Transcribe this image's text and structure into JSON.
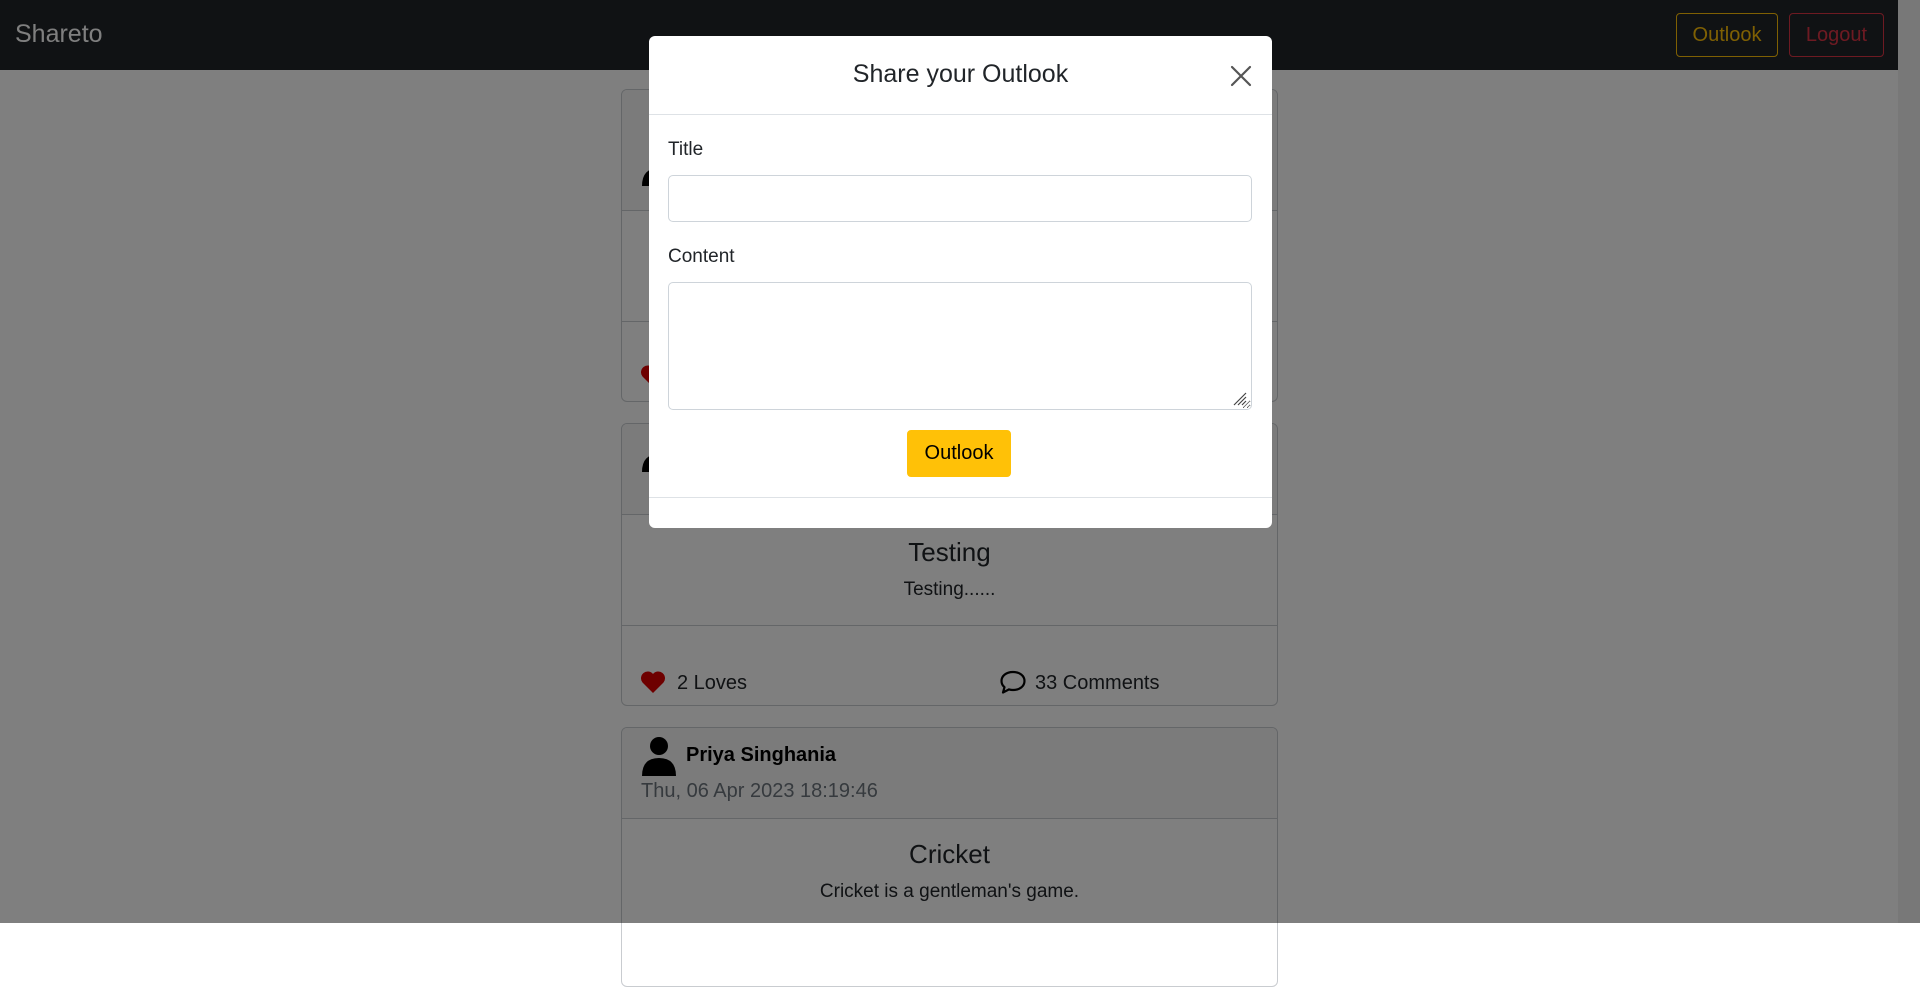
{
  "navbar": {
    "brand": "Shareto",
    "outlook_label": "Outlook",
    "logout_label": "Logout"
  },
  "feed": {
    "posts": [
      {
        "author": "",
        "time": "",
        "title": "",
        "content": "",
        "loves": "",
        "comments": ""
      },
      {
        "author": "",
        "time": "",
        "title": "Testing",
        "content": "Testing......",
        "loves": "2 Loves",
        "comments": "33 Comments"
      },
      {
        "author": "Priya Singhania",
        "time": "Thu, 06 Apr 2023 18:19:46",
        "title": "Cricket",
        "content": "Cricket is a gentleman's game."
      }
    ]
  },
  "modal": {
    "title": "Share your Outlook",
    "title_label": "Title",
    "title_value": "",
    "content_label": "Content",
    "content_value": "",
    "submit_label": "Outlook"
  },
  "colors": {
    "accent": "#ffc107",
    "danger": "#dc3545",
    "heart": "#dc0000",
    "navbar": "#212529"
  },
  "icons": {
    "close": "close-icon",
    "person": "person-icon",
    "heart": "heart-icon",
    "comment": "comment-icon"
  }
}
